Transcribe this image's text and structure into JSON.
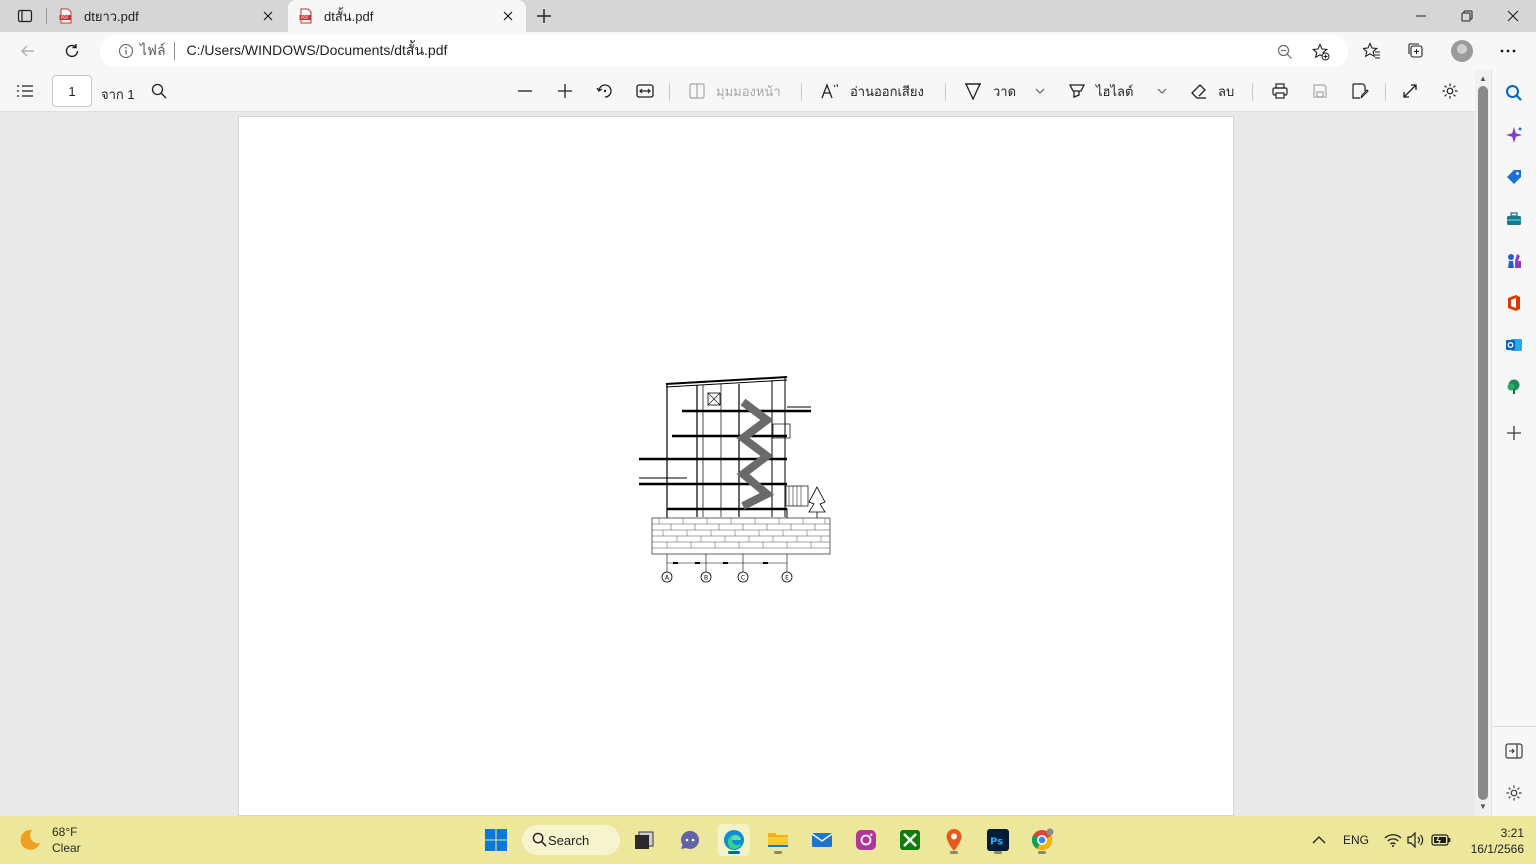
{
  "browser": {
    "tabs": [
      {
        "title": "dtยาว.pdf",
        "active": false
      },
      {
        "title": "dtสั้น.pdf",
        "active": true
      }
    ],
    "address": {
      "scheme_label": "ไฟล์",
      "url": "C:/Users/WINDOWS/Documents/dtสั้น.pdf"
    }
  },
  "pdf_toolbar": {
    "page_number": "1",
    "page_total": "จาก 1",
    "page_view_label": "มุมมองหน้า",
    "read_aloud_label": "อ่านออกเสียง",
    "draw_label": "วาด",
    "highlight_label": "ไฮไลต์",
    "erase_label": "ลบ"
  },
  "drawing": {
    "grid_labels": [
      "A",
      "B",
      "C",
      "E"
    ]
  },
  "taskbar": {
    "weather_temp": "68°F",
    "weather_desc": "Clear",
    "search_label": "Search",
    "language": "ENG",
    "time": "3:21",
    "date": "16/1/2566"
  },
  "colors": {
    "accent": "#0067c0",
    "taskbar_bg": "#ece79a",
    "pdf_icon_red": "#c5312c"
  }
}
